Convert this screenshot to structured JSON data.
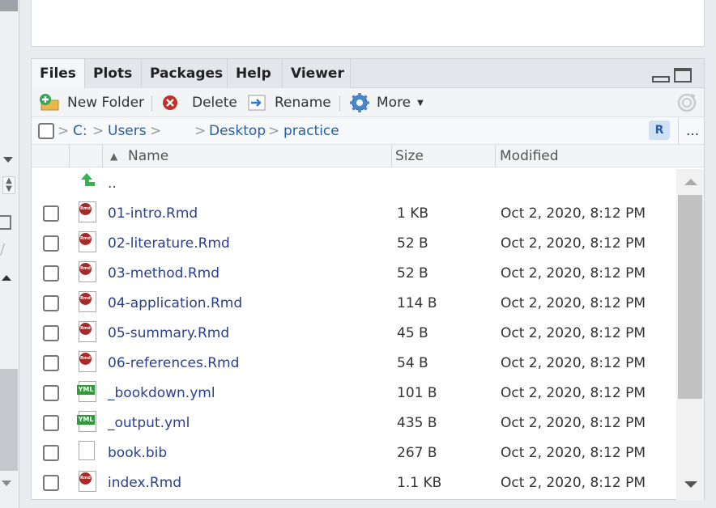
{
  "tabs": [
    {
      "label": "Files"
    },
    {
      "label": "Plots"
    },
    {
      "label": "Packages"
    },
    {
      "label": "Help"
    },
    {
      "label": "Viewer"
    }
  ],
  "toolbar": {
    "new_folder": "New Folder",
    "delete": "Delete",
    "rename": "Rename",
    "more": "More"
  },
  "path": {
    "drive": "C:",
    "users": "Users",
    "desktop": "Desktop",
    "practice": "practice",
    "more": "..."
  },
  "columns": {
    "name": "Name",
    "size": "Size",
    "modified": "Modified"
  },
  "parent_dir": "..",
  "files": [
    {
      "name": "01-intro.Rmd",
      "size": "1 KB",
      "modified": "Oct 2, 2020, 8:12 PM",
      "icon": "rmd-file-icon"
    },
    {
      "name": "02-literature.Rmd",
      "size": "52 B",
      "modified": "Oct 2, 2020, 8:12 PM",
      "icon": "rmd-file-icon"
    },
    {
      "name": "03-method.Rmd",
      "size": "52 B",
      "modified": "Oct 2, 2020, 8:12 PM",
      "icon": "rmd-file-icon"
    },
    {
      "name": "04-application.Rmd",
      "size": "114 B",
      "modified": "Oct 2, 2020, 8:12 PM",
      "icon": "rmd-file-icon"
    },
    {
      "name": "05-summary.Rmd",
      "size": "45 B",
      "modified": "Oct 2, 2020, 8:12 PM",
      "icon": "rmd-file-icon"
    },
    {
      "name": "06-references.Rmd",
      "size": "54 B",
      "modified": "Oct 2, 2020, 8:12 PM",
      "icon": "rmd-file-icon"
    },
    {
      "name": "_bookdown.yml",
      "size": "101 B",
      "modified": "Oct 2, 2020, 8:12 PM",
      "icon": "yml-file-icon"
    },
    {
      "name": "_output.yml",
      "size": "435 B",
      "modified": "Oct 2, 2020, 8:12 PM",
      "icon": "yml-file-icon"
    },
    {
      "name": "book.bib",
      "size": "267 B",
      "modified": "Oct 2, 2020, 8:12 PM",
      "icon": "blank-file-icon"
    },
    {
      "name": "index.Rmd",
      "size": "1.1 KB",
      "modified": "Oct 2, 2020, 8:12 PM",
      "icon": "rmd-file-icon"
    }
  ],
  "icon_text": {
    "rmd": "Rmd",
    "yml": "YML",
    "r_project": "R"
  },
  "colors": {
    "link": "#2a5d9f",
    "file_link": "#2a3f8f",
    "rmd_badge": "#a52a2a",
    "yml_badge": "#2e9a3a",
    "up_arrow": "#2db84d"
  }
}
